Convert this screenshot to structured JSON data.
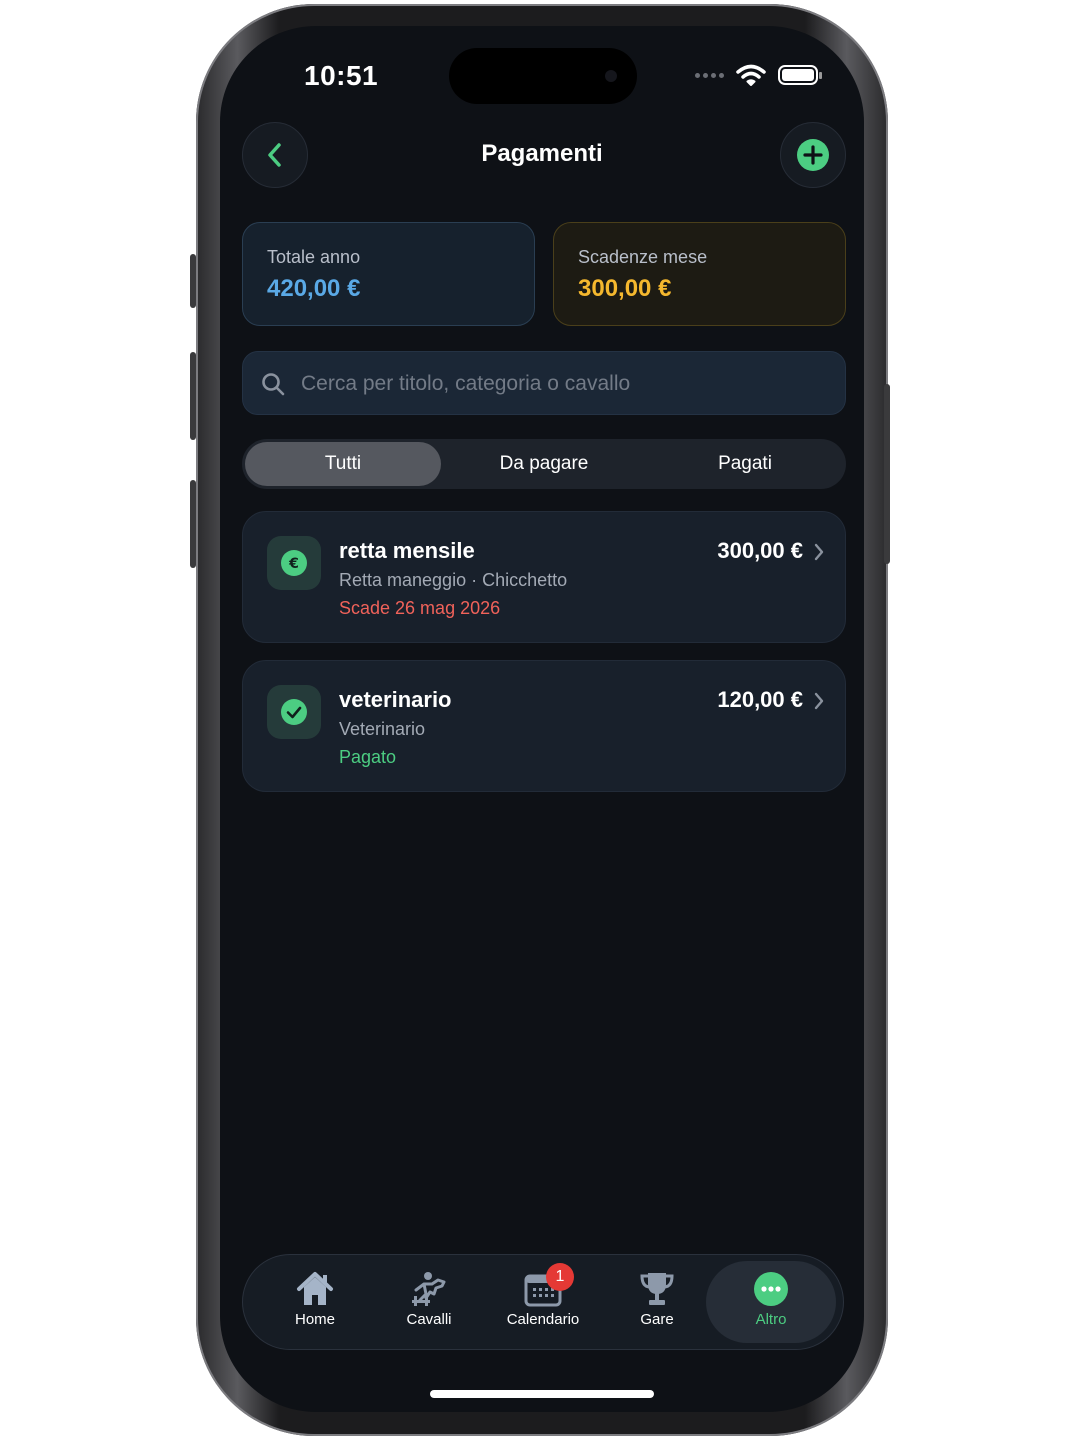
{
  "status_bar": {
    "time": "10:51"
  },
  "header": {
    "title": "Pagamenti"
  },
  "summary": {
    "year_total": {
      "label": "Totale anno",
      "value": "420,00 €",
      "color": "#5aa9e6"
    },
    "month_due": {
      "label": "Scadenze mese",
      "value": "300,00 €",
      "color": "#f5b82e"
    }
  },
  "search": {
    "placeholder": "Cerca per titolo, categoria o cavallo"
  },
  "filters": {
    "tabs": [
      "Tutti",
      "Da pagare",
      "Pagati"
    ],
    "selected": "Tutti"
  },
  "payments": [
    {
      "title": "retta mensile",
      "subtitle": "Retta maneggio · Chicchetto",
      "status": "Scade 26 mag 2026",
      "status_color": "#f0625a",
      "amount": "300,00 €",
      "icon": "euro-icon"
    },
    {
      "title": "veterinario",
      "subtitle": "Veterinario",
      "status": "Pagato",
      "status_color": "#4ccd82",
      "amount": "120,00 €",
      "icon": "check-icon"
    }
  ],
  "tabbar": {
    "items": [
      {
        "label": "Home",
        "icon": "home-icon"
      },
      {
        "label": "Cavalli",
        "icon": "horse-jump-icon"
      },
      {
        "label": "Calendario",
        "icon": "calendar-icon",
        "badge": "1"
      },
      {
        "label": "Gare",
        "icon": "trophy-icon"
      },
      {
        "label": "Altro",
        "icon": "more-icon"
      }
    ],
    "selected": "Altro"
  },
  "colors": {
    "accent": "#4ccd82",
    "background": "#0e1116"
  }
}
